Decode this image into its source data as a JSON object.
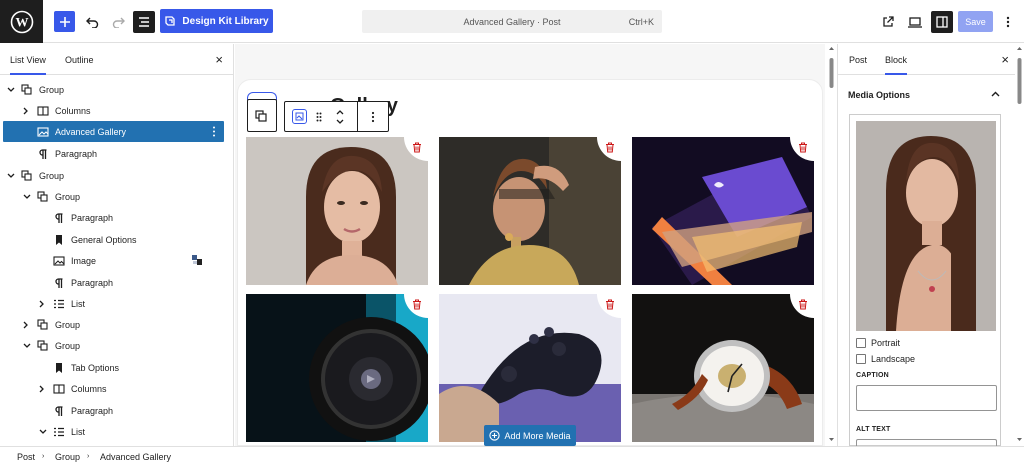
{
  "topbar": {
    "add_label": "+",
    "design_kit_label": "Design Kit Library",
    "command_title": "Advanced Gallery · Post",
    "command_shortcut": "Ctrl+K",
    "save_label": "Save"
  },
  "left_panel": {
    "tabs": [
      "List View",
      "Outline"
    ],
    "close": "×",
    "tree": [
      {
        "label": "Group",
        "icon": "group-icon",
        "chev": "v"
      },
      {
        "label": "Columns",
        "icon": "columns-icon",
        "chev": ">"
      },
      {
        "label": "Advanced Gallery",
        "icon": "gallery-icon",
        "chev": ""
      },
      {
        "label": "Paragraph",
        "icon": "paragraph-icon",
        "chev": ""
      },
      {
        "label": "Group",
        "icon": "group-icon",
        "chev": "v"
      },
      {
        "label": "Group",
        "icon": "group-icon",
        "chev": "v"
      },
      {
        "label": "Paragraph",
        "icon": "paragraph-icon",
        "chev": ""
      },
      {
        "label": "General Options",
        "icon": "bookmark-icon",
        "chev": ""
      },
      {
        "label": "Image",
        "icon": "image-icon",
        "chev": ""
      },
      {
        "label": "Paragraph",
        "icon": "paragraph-icon",
        "chev": ""
      },
      {
        "label": "List",
        "icon": "list-icon",
        "chev": ">"
      },
      {
        "label": "Group",
        "icon": "group-icon",
        "chev": ">"
      },
      {
        "label": "Group",
        "icon": "group-icon",
        "chev": "v"
      },
      {
        "label": "Tab Options",
        "icon": "bookmark-icon",
        "chev": ""
      },
      {
        "label": "Columns",
        "icon": "columns-icon",
        "chev": ">"
      },
      {
        "label": "Paragraph",
        "icon": "paragraph-icon",
        "chev": ""
      },
      {
        "label": "List",
        "icon": "list-icon",
        "chev": "v"
      }
    ]
  },
  "canvas": {
    "gallery_title": "Gallery",
    "tiles": [
      {
        "name": "portrait-woman",
        "colors": [
          "#c8c2bc",
          "#5a3a2a"
        ]
      },
      {
        "name": "woman-shadow",
        "colors": [
          "#2b2a26",
          "#c8a060"
        ]
      },
      {
        "name": "laptop",
        "colors": [
          "#1a1030",
          "#c070d0"
        ]
      },
      {
        "name": "speaker",
        "colors": [
          "#0b1a22",
          "#1aa0c0"
        ]
      },
      {
        "name": "game-controller",
        "colors": [
          "#e6e6f0",
          "#2a2a40"
        ]
      },
      {
        "name": "watch",
        "colors": [
          "#1a1816",
          "#6a6a68"
        ]
      }
    ],
    "add_more_label": "Add More Media"
  },
  "right_panel": {
    "tabs": [
      "Post",
      "Block"
    ],
    "close": "×",
    "section_title": "Media Options",
    "portrait_label": "Portrait",
    "landscape_label": "Landscape",
    "caption_label": "CAPTION",
    "alt_label": "ALT TEXT"
  },
  "footer": {
    "crumbs": [
      "Post",
      "Group",
      "Advanced Gallery"
    ]
  },
  "colors": {
    "accent": "#3858e9",
    "selection": "#2271b1",
    "delete": "#cc1818"
  }
}
